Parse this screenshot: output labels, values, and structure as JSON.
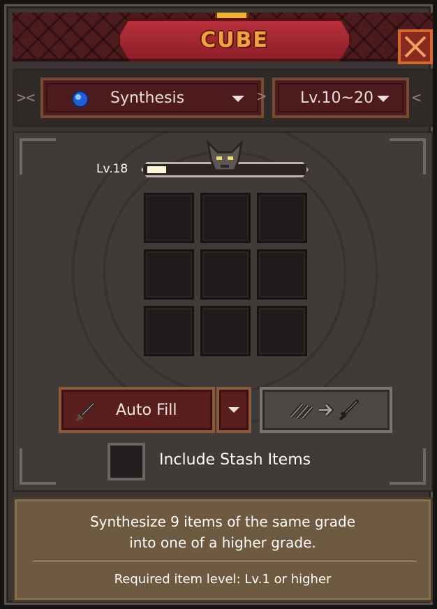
{
  "header": {
    "title": "CUBE",
    "close_icon": "close-icon"
  },
  "filters": {
    "mode": {
      "label": "Synthesis",
      "icon": "blue-gem-icon"
    },
    "level_range": {
      "label": "Lv.10~20"
    }
  },
  "cube": {
    "level_label": "Lv.18",
    "xp_progress": 0.12,
    "slots": 9,
    "mascot_icon": "demon-head-icon"
  },
  "actions": {
    "auto_fill_label": "Auto Fill",
    "synthesize_icon": "items-to-sword-icon"
  },
  "options": {
    "include_stash_label": "Include Stash Items",
    "include_stash_checked": false
  },
  "info": {
    "description_line1": "Synthesize 9 items of the same grade",
    "description_line2": "into one of a higher grade.",
    "requirement": "Required item level: Lv.1 or higher"
  },
  "colors": {
    "title": "#f2a23a",
    "header_red": "#b8303b",
    "info_bg": "#6e5a40"
  }
}
